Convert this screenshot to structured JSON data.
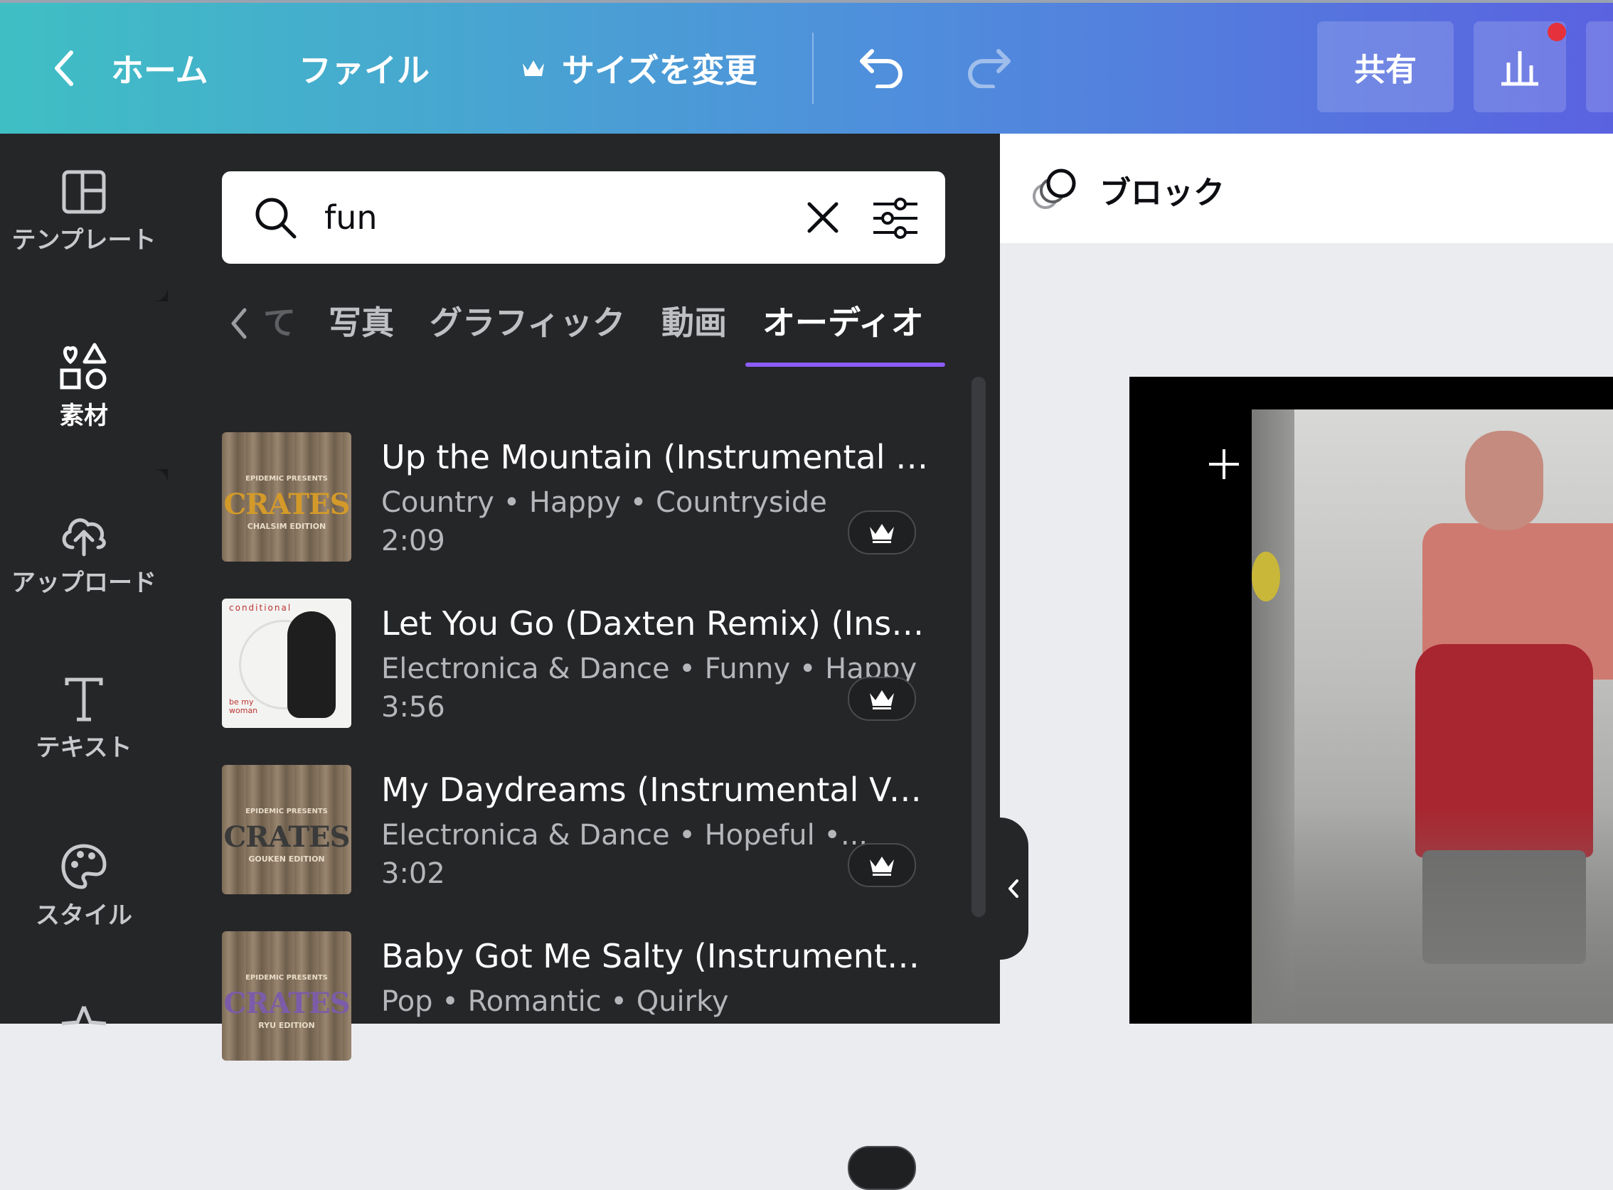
{
  "topbar": {
    "home_label": "ホーム",
    "file_label": "ファイル",
    "resize_label": "サイズを変更",
    "share_label": "共有"
  },
  "rail": {
    "items": [
      {
        "label": "テンプレート",
        "icon": "template-icon"
      },
      {
        "label": "素材",
        "icon": "elements-icon",
        "active": true
      },
      {
        "label": "アップロード",
        "icon": "upload-icon"
      },
      {
        "label": "テキスト",
        "icon": "text-icon"
      },
      {
        "label": "スタイル",
        "icon": "palette-icon"
      },
      {
        "label": "",
        "icon": "star-icon"
      }
    ]
  },
  "search": {
    "value": "fun"
  },
  "tabs": {
    "partial": "て",
    "items": [
      "写真",
      "グラフィック",
      "動画",
      "オーディオ"
    ],
    "active": "オーディオ"
  },
  "tracks": [
    {
      "title": "Up the Mountain (Instrumental V...",
      "meta": "Country • Happy • Countryside",
      "duration": "2:09",
      "cover": {
        "brand": "CRATES",
        "subtitle": "CHALSIM EDITION",
        "presenter": "EPIDEMIC PRESENTS",
        "color": "#d39a2a"
      }
    },
    {
      "title": "Let You Go (Daxten Remix) (Instru...",
      "meta": "Electronica & Dance • Funny • Happy",
      "duration": "3:56",
      "cover": {
        "top_text": "conditional",
        "side_text": "be my woman"
      }
    },
    {
      "title": "My Daydreams (Instrumental Ver...",
      "meta": "Electronica & Dance • Hopeful •...",
      "duration": "3:02",
      "cover": {
        "brand": "CRATES",
        "subtitle": "GOUKEN EDITION",
        "presenter": "EPIDEMIC PRESENTS",
        "color": "#3a3a3a"
      }
    },
    {
      "title": "Baby Got Me Salty (Instrumental ...",
      "meta": "Pop • Romantic • Quirky",
      "duration": "",
      "cover": {
        "brand": "CRATES",
        "subtitle": "RYU EDITION",
        "presenter": "EPIDEMIC PRESENTS",
        "color": "#7b5ca8"
      }
    }
  ],
  "editor": {
    "context_label": "ブロック"
  },
  "colors": {
    "accent_tab": "#8b5cf6",
    "notification_dot": "#e5313b"
  }
}
